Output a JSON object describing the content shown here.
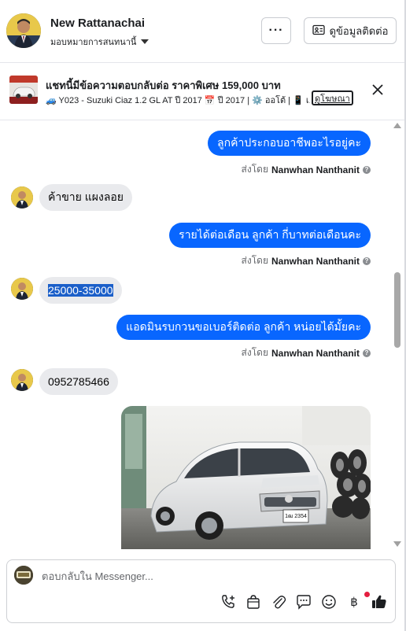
{
  "header": {
    "name": "New Rattanachai",
    "subtitle": "มอบหมายการสนทนานี้",
    "more_label": "···",
    "contact_label": "ดูข้อมูลติดต่อ"
  },
  "ad": {
    "title": "แชทนี้มีข้อความตอบกลับต่อ ราคาพิเศษ 159,000 บาท",
    "detail": "🚙 Y023 - Suzuki Ciaz 1.2 GL AT ปี 2017 📅 ปี 2017 | ⚙️ ออโต้ | 📱 เ...",
    "link_label": "ดูโฆษณา"
  },
  "messages": [
    {
      "text": "ลูกค้าประกอบอาชีพอะไรอยู่คะ",
      "sent_by_prefix": "ส่งโดย",
      "sender": "Nanwhan Nanthanit"
    },
    {
      "text": "ค้าขาย แผงลอย"
    },
    {
      "text": "รายได้ต่อเดือน ลูกค้า  กี่บาทต่อเดือนคะ",
      "sent_by_prefix": "ส่งโดย",
      "sender": "Nanwhan Nanthanit"
    },
    {
      "text": "25000-35000"
    },
    {
      "text": "แอดมินรบกวนขอเบอร์ติดต่อ ลูกค้า  หน่อยได้มั้ยคะ",
      "sent_by_prefix": "ส่งโดย",
      "sender": "Nanwhan Nanthanit"
    },
    {
      "text": "0952785466"
    }
  ],
  "photo": {
    "plate_top": "1ฒ 2354",
    "plate_bottom": ""
  },
  "composer": {
    "placeholder": "ตอบกลับใน Messenger..."
  },
  "icons": [
    "more-icon",
    "contact-card-icon",
    "close-icon",
    "phone-plus-icon",
    "shopping-bag-icon",
    "paperclip-icon",
    "chat-bubble-icon",
    "emoji-icon",
    "baht-icon",
    "thumbs-up-icon"
  ],
  "colors": {
    "accent": "#0866ff",
    "bubble_in": "#e9eaed",
    "like": "#1c1e21"
  }
}
